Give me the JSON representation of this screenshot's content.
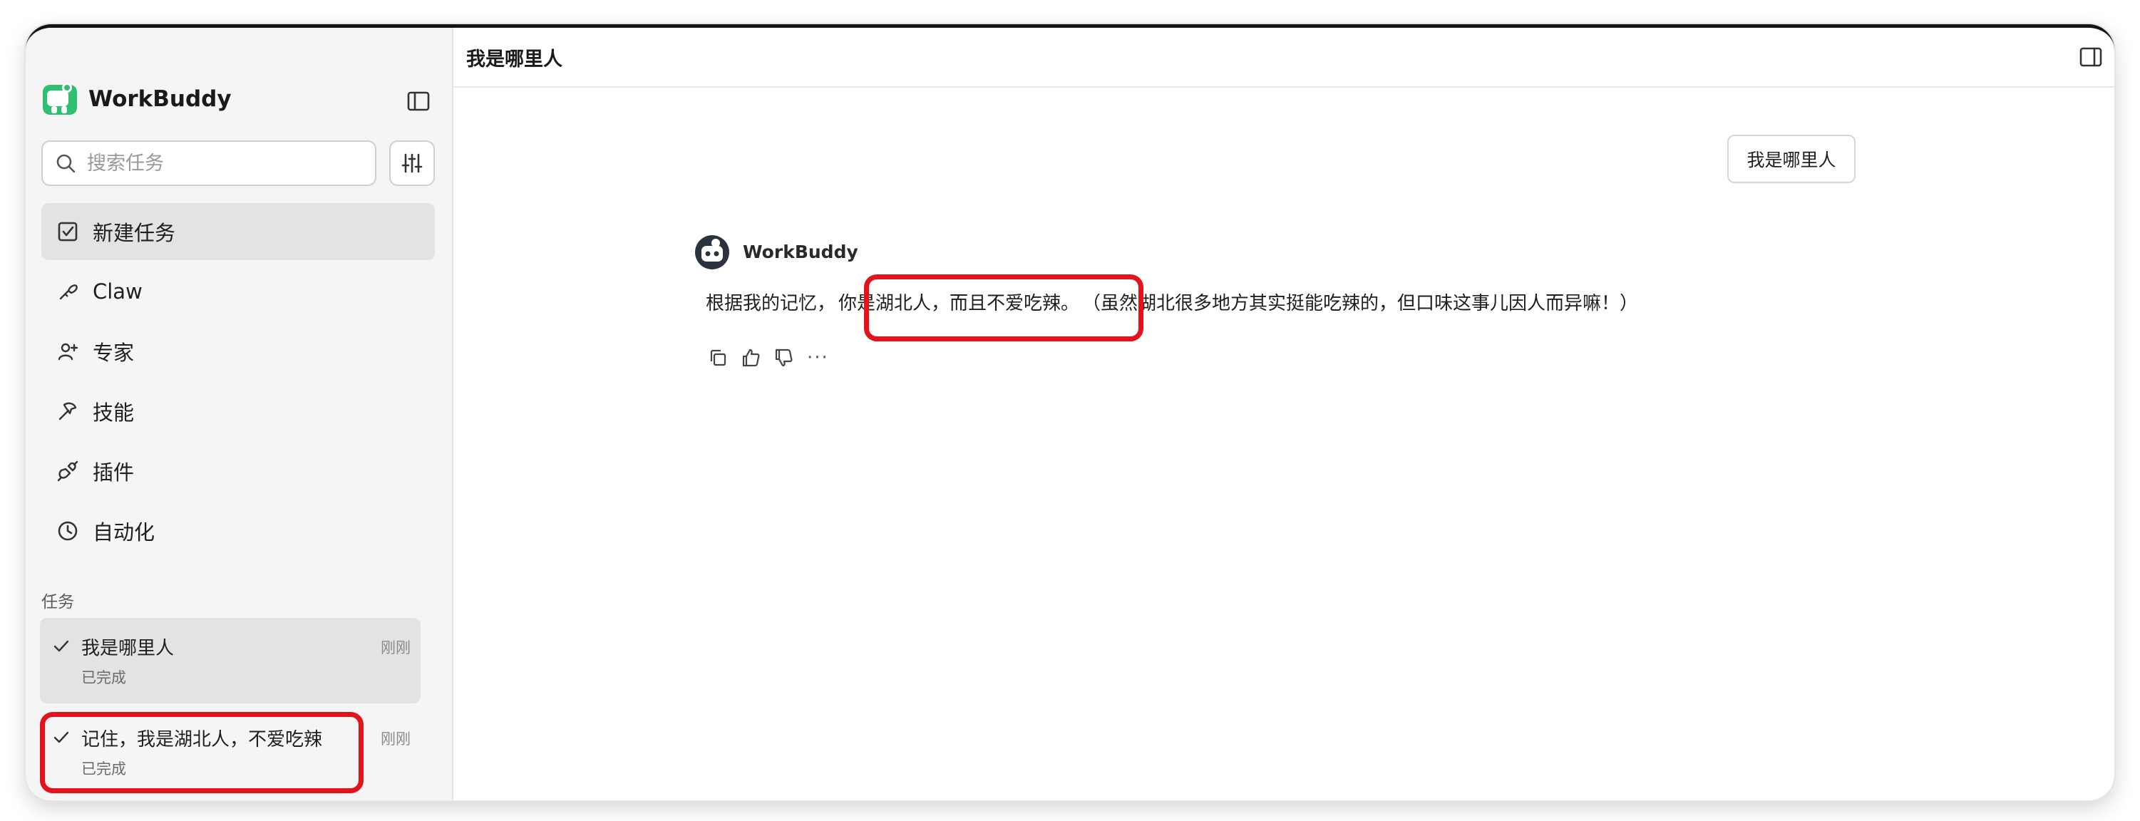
{
  "sidebar": {
    "brand_name": "WorkBuddy",
    "search_placeholder": "搜索任务",
    "nav": [
      {
        "label": "新建任务",
        "icon": "new-task-icon"
      },
      {
        "label": "Claw",
        "icon": "claw-icon"
      },
      {
        "label": "专家",
        "icon": "expert-icon"
      },
      {
        "label": "技能",
        "icon": "skill-icon"
      },
      {
        "label": "插件",
        "icon": "plugin-icon"
      },
      {
        "label": "自动化",
        "icon": "clock-icon"
      }
    ],
    "tasks_title": "任务",
    "tasks": [
      {
        "title": "我是哪里人",
        "status": "已完成",
        "time": "刚刚"
      },
      {
        "title": "记住，我是湖北人，不爱吃辣",
        "status": "已完成",
        "time": "刚刚"
      }
    ]
  },
  "main": {
    "title": "我是哪里人",
    "user_message": "我是哪里人",
    "assistant_name": "WorkBuddy",
    "reply_part1": "根据我的记忆，",
    "reply_part2": "你是湖北人，而且不爱吃辣。",
    "reply_part3": "（虽然湖北很多地方其实挺能吃辣的，但口味这事儿因人而异嘛！）",
    "more_label": "···"
  },
  "colors": {
    "highlight": "#e4131a",
    "brand_green": "#2fbf71",
    "sidebar_bg": "#f5f5f5",
    "active_bg": "#e3e3e3"
  }
}
